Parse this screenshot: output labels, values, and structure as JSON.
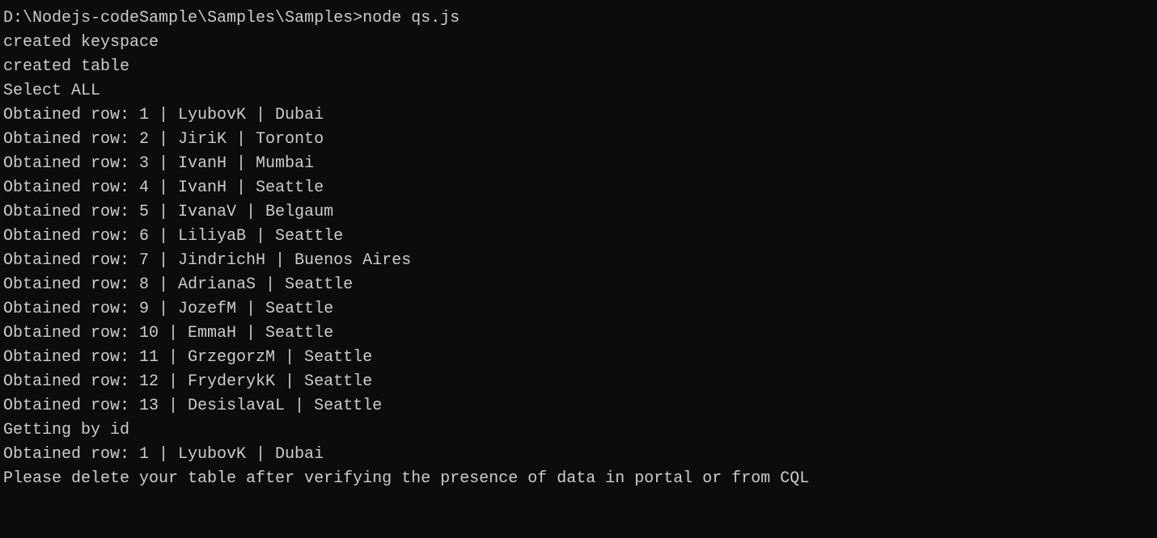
{
  "terminal": {
    "prompt": "D:\\Nodejs-codeSample\\Samples\\Samples>",
    "command": "node qs.js",
    "output": {
      "created_keyspace": "created keyspace",
      "created_table": "created table",
      "select_all": "Select ALL",
      "rows": [
        {
          "prefix": "Obtained row:",
          "id": "1",
          "name": "LyubovK",
          "city": "Dubai"
        },
        {
          "prefix": "Obtained row:",
          "id": "2",
          "name": "JiriK",
          "city": "Toronto"
        },
        {
          "prefix": "Obtained row:",
          "id": "3",
          "name": "IvanH",
          "city": "Mumbai"
        },
        {
          "prefix": "Obtained row:",
          "id": "4",
          "name": "IvanH",
          "city": "Seattle"
        },
        {
          "prefix": "Obtained row:",
          "id": "5",
          "name": "IvanaV",
          "city": "Belgaum"
        },
        {
          "prefix": "Obtained row:",
          "id": "6",
          "name": "LiliyaB",
          "city": "Seattle"
        },
        {
          "prefix": "Obtained row:",
          "id": "7",
          "name": "JindrichH",
          "city": "Buenos Aires"
        },
        {
          "prefix": "Obtained row:",
          "id": "8",
          "name": "AdrianaS",
          "city": "Seattle"
        },
        {
          "prefix": "Obtained row:",
          "id": "9",
          "name": "JozefM",
          "city": "Seattle"
        },
        {
          "prefix": "Obtained row:",
          "id": "10",
          "name": "EmmaH",
          "city": "Seattle"
        },
        {
          "prefix": "Obtained row:",
          "id": "11",
          "name": "GrzegorzM",
          "city": "Seattle"
        },
        {
          "prefix": "Obtained row:",
          "id": "12",
          "name": "FryderykK",
          "city": "Seattle"
        },
        {
          "prefix": "Obtained row:",
          "id": "13",
          "name": "DesislavaL",
          "city": "Seattle"
        }
      ],
      "getting_by_id": "Getting by id",
      "by_id_row": {
        "prefix": "Obtained row:",
        "id": "1",
        "name": "LyubovK",
        "city": "Dubai"
      },
      "final_message": "Please delete your table after verifying the presence of data in portal or from CQL"
    }
  }
}
